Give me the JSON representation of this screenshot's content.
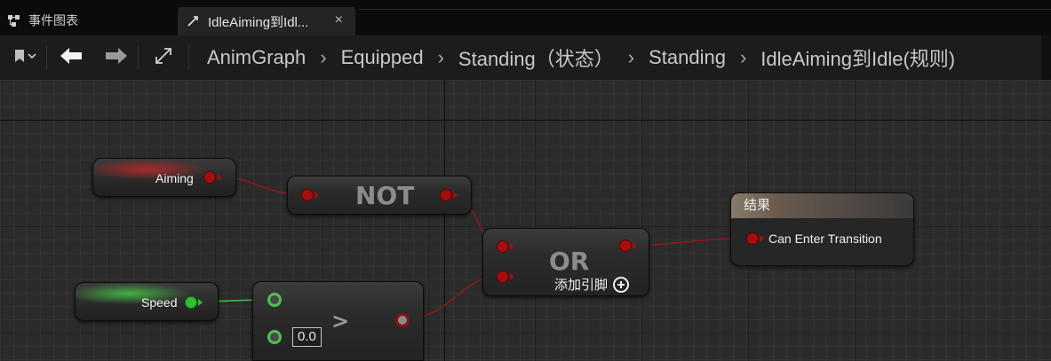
{
  "tabs": [
    {
      "label": "事件图表",
      "active": false,
      "icon": "event-graph-icon"
    },
    {
      "label": "IdleAiming到Idl...",
      "active": true,
      "icon": "transition-icon"
    }
  ],
  "tab_close": "×",
  "toolbar": {
    "bookmark_icon": "bookmark-icon",
    "back_icon": "arrow-left-icon",
    "forward_icon": "arrow-right-icon",
    "expand_icon": "expand-icon"
  },
  "breadcrumb": [
    "AnimGraph",
    "Equipped",
    "Standing（状态）",
    "Standing",
    "IdleAiming到Idle(规则)"
  ],
  "breadcrumb_separator": "›",
  "nodes": {
    "aiming": {
      "label": "Aiming",
      "color": "#a40e0e"
    },
    "speed": {
      "label": "Speed",
      "color": "#2fbf2f"
    },
    "not": {
      "title": "NOT"
    },
    "or": {
      "title": "OR",
      "add_pin_label": "添加引脚"
    },
    "greater": {
      "title": ">",
      "default_value": "0.0"
    },
    "result": {
      "title": "结果",
      "pin_label": "Can Enter Transition"
    }
  },
  "colors": {
    "bool_wire": "#8a1a1a",
    "float_wire": "#3ec03e",
    "graph_bg": "#2b2b2b"
  }
}
